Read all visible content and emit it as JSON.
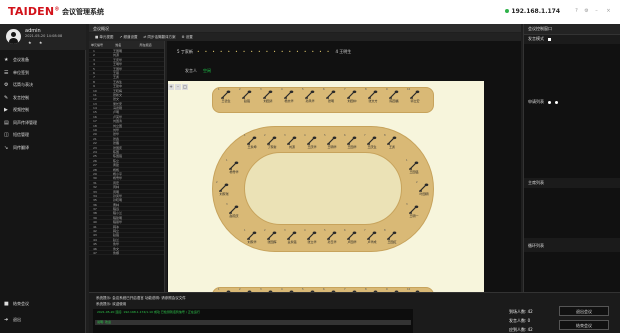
{
  "app": {
    "brand": "TAIDEN",
    "title": "会议管理系统",
    "ip": "192.168.1.174"
  },
  "user": {
    "name": "admin",
    "time": "2021-05-20 14:08:08",
    "stars": "★ ★"
  },
  "nav": [
    {
      "icon": "★",
      "label": "会议准备"
    },
    {
      "icon": "☰",
      "label": "单位签到"
    },
    {
      "icon": "⚙",
      "label": "话筒与表决"
    },
    {
      "icon": "✎",
      "label": "发言控制"
    },
    {
      "icon": "▶",
      "label": "视频控制"
    },
    {
      "icon": "▤",
      "label": "同声传译管理"
    },
    {
      "icon": "◫",
      "label": "短信管理"
    },
    {
      "icon": "↘",
      "label": "同传翻译"
    }
  ],
  "side_bottom": [
    {
      "icon": "■",
      "label": "结束会议"
    },
    {
      "icon": "➜",
      "label": "退出"
    }
  ],
  "center_head": "会议概况",
  "toolbar": [
    "■ 单元视图",
    "↗ 频道设置",
    "⇄ 同步话筒翻译方案",
    "⚙ 设置"
  ],
  "seat_header": [
    "单元编号",
    "姓名",
    "所在频道"
  ],
  "seats": [
    [
      "1",
      "王国明"
    ],
    [
      "2",
      "刘源"
    ],
    [
      "3",
      "王庆华"
    ],
    [
      "4",
      "王明华"
    ],
    [
      "5",
      "王国华"
    ],
    [
      "6",
      "王丽"
    ],
    [
      "7",
      "王勇"
    ],
    [
      "8",
      "王春生"
    ],
    [
      "9",
      "王建中"
    ],
    [
      "10",
      "王晓梅"
    ],
    [
      "11",
      "张新文"
    ],
    [
      "12",
      "张文"
    ],
    [
      "13",
      "吴长安"
    ],
    [
      "14",
      "冯德刚"
    ],
    [
      "15",
      "卢明"
    ],
    [
      "16",
      "卢英华"
    ],
    [
      "17",
      "刘国清"
    ],
    [
      "18",
      "刘立国"
    ],
    [
      "19",
      "刘华"
    ],
    [
      "20",
      "张华"
    ],
    [
      "21",
      "张鑫"
    ],
    [
      "22",
      "张雁"
    ],
    [
      "23",
      "张国庆"
    ],
    [
      "24",
      "陈国"
    ],
    [
      "25",
      "陈国强"
    ],
    [
      "26",
      "陈立"
    ],
    [
      "27",
      "黄建"
    ],
    [
      "28",
      "杨帆"
    ],
    [
      "29",
      "杨小平"
    ],
    [
      "30",
      "杨雪华"
    ],
    [
      "31",
      "周宏"
    ],
    [
      "32",
      "周林"
    ],
    [
      "33",
      "周明"
    ],
    [
      "34",
      "孙凤华"
    ],
    [
      "35",
      "孙晓明"
    ],
    [
      "36",
      "曹林"
    ],
    [
      "37",
      "程远"
    ],
    [
      "38",
      "程小兰"
    ],
    [
      "39",
      "程建明"
    ],
    [
      "40",
      "程丽华"
    ],
    [
      "41",
      "韩冰"
    ],
    [
      "42",
      "韩立"
    ],
    [
      "43",
      "赵强"
    ],
    [
      "44",
      "赵兰"
    ],
    [
      "45",
      "鲁华"
    ],
    [
      "46",
      "鲁文"
    ],
    [
      "47",
      "鲁娜"
    ]
  ],
  "steps": {
    "from": "5 丁家新",
    "to": "4 王明生"
  },
  "mode": {
    "label": "发言人",
    "value": "空闲"
  },
  "zoom": [
    "+",
    "-",
    "□"
  ],
  "top_row": [
    "王德生",
    "赵强",
    "刘国清",
    "杨文华",
    "孙凤华",
    "张明",
    "刘国中",
    "张文方",
    "陈国福",
    "郭立宏"
  ],
  "oval_top": [
    "王永坤",
    "丁家新",
    "刘源",
    "王庆华",
    "王明华",
    "王国华",
    "王庆生",
    "王勇"
  ],
  "oval_left": [
    "杨雪华",
    "刘家瑞",
    "赵晓庆"
  ],
  "oval_right": [
    "王国铭",
    "叶国明",
    "王明一"
  ],
  "oval_bottom": [
    "刘家华",
    "张国辉",
    "袁永强",
    "张立华",
    "孙玉华",
    "卢国华",
    "卢华成",
    "王国红"
  ],
  "bottom_row": [
    "王大华",
    "刘凤鑫",
    "赵凤清",
    "陈小琴",
    "吴国钰",
    "袁华",
    "刘小华",
    "吴玉峰",
    "陈建国",
    "王国强"
  ],
  "right": {
    "title": "会议控制窗口",
    "speak_mode_label": "发言模式",
    "vote_label": "申请列表",
    "vote_opts": "● ●",
    "apply_label": "主席列表",
    "queue_label": "循环列表"
  },
  "bottom": {
    "line1": "系统提示: 会议系统已开启语言   功能说明: 请参照会议文件",
    "line2": "系统提示: 欢迎使用",
    "log": "2021-05-20  连接: 192.168.1.174/1.10 成功 已检测到话筒信号 / 正在运行",
    "input": "说明: 欢迎",
    "stats": [
      "到场人数: 42",
      "发言人数: 0",
      "应到人数: 42"
    ],
    "btn1": "退出会议",
    "btn2": "结束会议"
  },
  "colors": {
    "accent": "#d2121a",
    "status": "#2fb24a",
    "seat_bar": "#d9b976",
    "canvas_bg": "#f7f5dc"
  }
}
